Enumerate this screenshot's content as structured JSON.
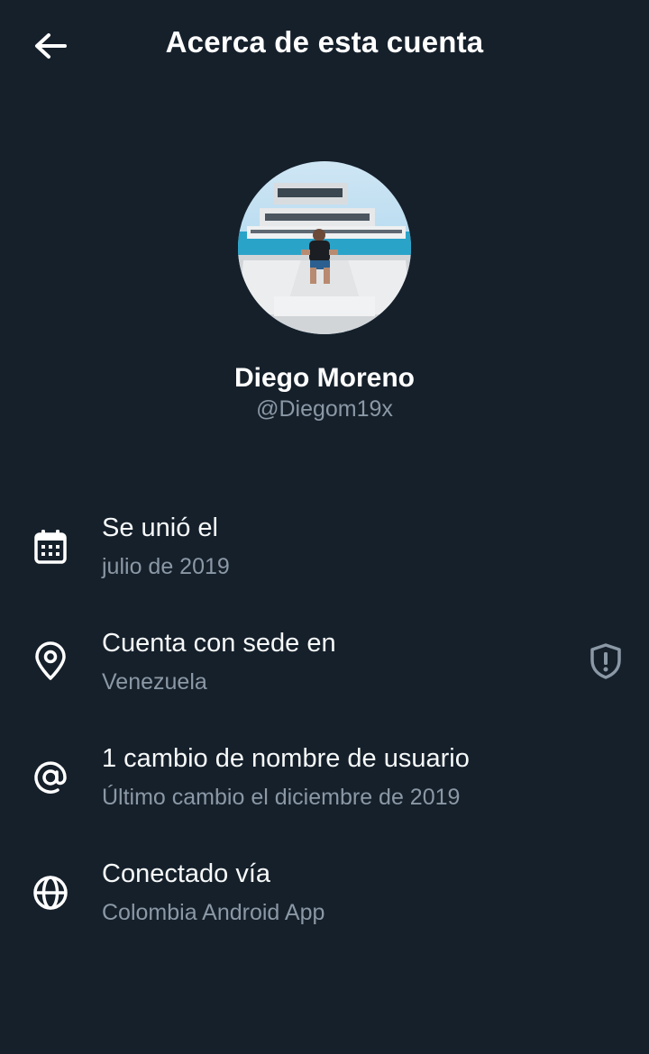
{
  "header": {
    "title": "Acerca de esta cuenta",
    "back_icon": "arrow-left-icon"
  },
  "profile": {
    "display_name": "Diego Moreno",
    "handle": "@Diegom19x",
    "avatar_icon": "profile-photo"
  },
  "rows": [
    {
      "icon": "calendar-icon",
      "title": "Se unió el",
      "subtitle": "julio de 2019"
    },
    {
      "icon": "location-pin-icon",
      "title": "Cuenta con sede en",
      "subtitle": "Venezuela",
      "action_icon": "shield-alert-icon"
    },
    {
      "icon": "at-sign-icon",
      "title": "1 cambio de nombre de usuario",
      "subtitle": "Último cambio el diciembre de 2019"
    },
    {
      "icon": "globe-icon",
      "title": "Conectado vía",
      "subtitle": "Colombia Android App"
    }
  ],
  "colors": {
    "background": "#15202b",
    "primary_text": "#ffffff",
    "secondary_text": "#8b98a5"
  }
}
